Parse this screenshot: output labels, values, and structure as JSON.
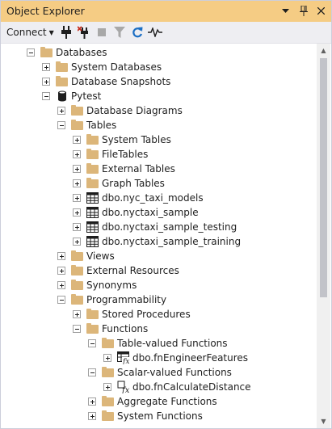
{
  "panel": {
    "title": "Object Explorer",
    "title_icons": [
      "dropdown-icon",
      "pin-icon",
      "close-icon"
    ],
    "colors": {
      "title_bar": "#f5cc84",
      "toolbar": "#eeeef2",
      "folder": "#dcb67a"
    }
  },
  "toolbar": {
    "connect_label": "Connect",
    "buttons": [
      "connect-plug-icon",
      "disconnect-plug-icon",
      "stop-icon",
      "filter-icon",
      "refresh-icon",
      "activity-monitor-icon"
    ]
  },
  "tree": [
    {
      "label": "Databases",
      "icon": "folder-icon",
      "expander": "minus"
    },
    {
      "label": "System Databases",
      "icon": "folder-icon",
      "expander": "plus"
    },
    {
      "label": "Database Snapshots",
      "icon": "folder-icon",
      "expander": "plus"
    },
    {
      "label": "Pytest",
      "icon": "database-icon",
      "expander": "minus"
    },
    {
      "label": "Database Diagrams",
      "icon": "folder-icon",
      "expander": "plus"
    },
    {
      "label": "Tables",
      "icon": "folder-icon",
      "expander": "minus"
    },
    {
      "label": "System Tables",
      "icon": "folder-icon",
      "expander": "plus"
    },
    {
      "label": "FileTables",
      "icon": "folder-icon",
      "expander": "plus"
    },
    {
      "label": "External Tables",
      "icon": "folder-icon",
      "expander": "plus"
    },
    {
      "label": "Graph Tables",
      "icon": "folder-icon",
      "expander": "plus"
    },
    {
      "label": "dbo.nyc_taxi_models",
      "icon": "table-icon",
      "expander": "plus"
    },
    {
      "label": "dbo.nyctaxi_sample",
      "icon": "table-icon",
      "expander": "plus"
    },
    {
      "label": "dbo.nyctaxi_sample_testing",
      "icon": "table-icon",
      "expander": "plus"
    },
    {
      "label": "dbo.nyctaxi_sample_training",
      "icon": "table-icon",
      "expander": "plus"
    },
    {
      "label": "Views",
      "icon": "folder-icon",
      "expander": "plus"
    },
    {
      "label": "External Resources",
      "icon": "folder-icon",
      "expander": "plus"
    },
    {
      "label": "Synonyms",
      "icon": "folder-icon",
      "expander": "plus"
    },
    {
      "label": "Programmability",
      "icon": "folder-icon",
      "expander": "minus"
    },
    {
      "label": "Stored Procedures",
      "icon": "folder-icon",
      "expander": "plus"
    },
    {
      "label": "Functions",
      "icon": "folder-icon",
      "expander": "minus"
    },
    {
      "label": "Table-valued Functions",
      "icon": "folder-icon",
      "expander": "minus"
    },
    {
      "label": "dbo.fnEngineerFeatures",
      "icon": "table-function-icon",
      "expander": "plus"
    },
    {
      "label": "Scalar-valued Functions",
      "icon": "folder-icon",
      "expander": "minus"
    },
    {
      "label": "dbo.fnCalculateDistance",
      "icon": "scalar-function-icon",
      "expander": "plus"
    },
    {
      "label": "Aggregate Functions",
      "icon": "folder-icon",
      "expander": "plus"
    },
    {
      "label": "System Functions",
      "icon": "folder-icon",
      "expander": "plus"
    }
  ]
}
